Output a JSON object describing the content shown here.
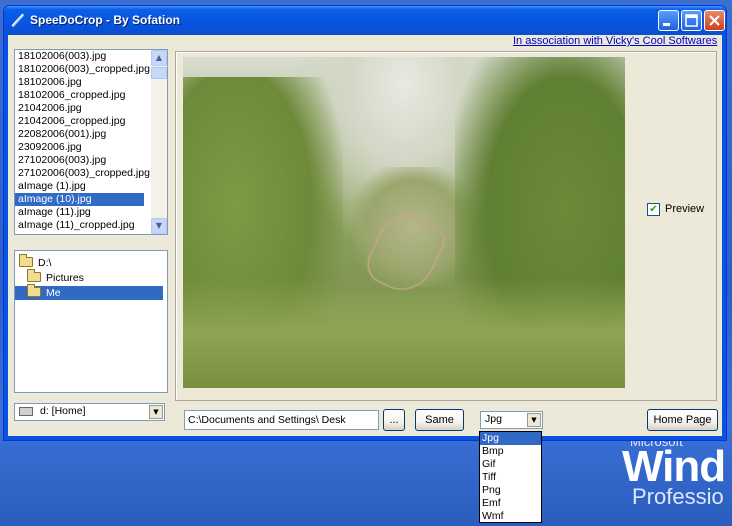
{
  "window": {
    "title": "SpeeDoCrop - By Sofation",
    "association_link": "In association with Vicky's Cool Softwares"
  },
  "file_list": {
    "items": [
      "18102006(003).jpg",
      "18102006(003)_cropped.jpg",
      "18102006.jpg",
      "18102006_cropped.jpg",
      "21042006.jpg",
      "21042006_cropped.jpg",
      "22082006(001).jpg",
      "23092006.jpg",
      "27102006(003).jpg",
      "27102006(003)_cropped.jpg",
      "aImage (1).jpg",
      "aImage (10).jpg",
      "aImage (11).jpg",
      "aImage (11)_cropped.jpg"
    ],
    "selected": "aImage (10).jpg"
  },
  "directory_tree": {
    "items": [
      "D:\\",
      "Pictures",
      "Me"
    ],
    "selected": "Me"
  },
  "drive": {
    "value": "d: [Home]"
  },
  "preview": {
    "label": "Preview",
    "checked": true,
    "check_glyph": "✔"
  },
  "output": {
    "path": "C:\\Documents and Settings\\          Desk",
    "browse_label": "...",
    "same_label": "Same",
    "home_label": "Home Page"
  },
  "format": {
    "selected": "Jpg",
    "options": [
      "Jpg",
      "Bmp",
      "Gif",
      "Tiff",
      "Png",
      "Emf",
      "Wmf"
    ]
  },
  "desktop": {
    "brand_small": "Microsoft",
    "brand_large": "Wind",
    "edition": "Professio"
  },
  "colors": {
    "selection": "#316ac5",
    "titlebar": "#0a5fe6",
    "window_bg": "#ece9d8"
  }
}
